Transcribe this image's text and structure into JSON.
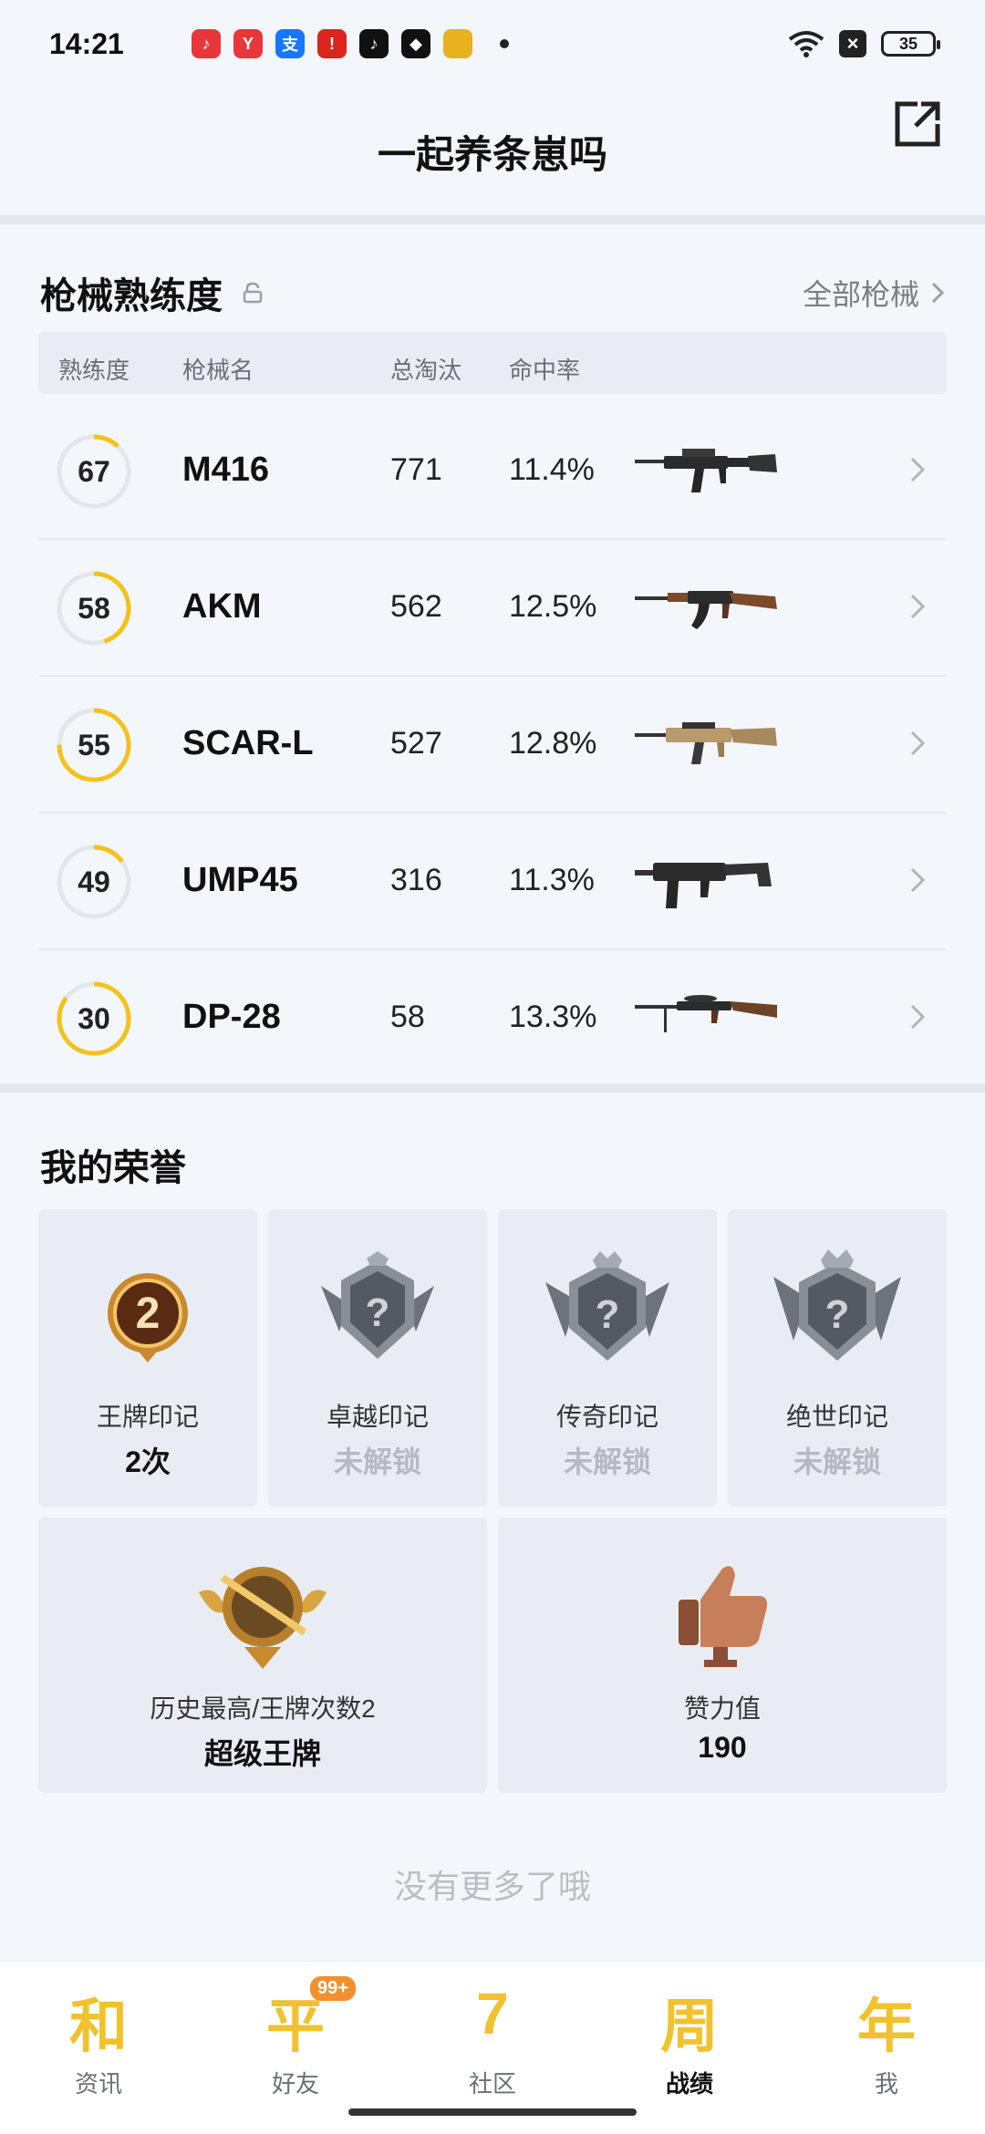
{
  "status_bar": {
    "time": "14:21",
    "battery": "35",
    "apps": [
      {
        "icon": "music-app-icon",
        "color": "#e8363a",
        "glyph": "♪"
      },
      {
        "icon": "red-app-icon",
        "color": "#e8363a",
        "glyph": "Y"
      },
      {
        "icon": "alipay-icon",
        "color": "#1677ff",
        "glyph": "支"
      },
      {
        "icon": "notice-app-icon",
        "color": "#d9251d",
        "glyph": "!"
      },
      {
        "icon": "tiktok-icon",
        "color": "#111111",
        "glyph": "♪"
      },
      {
        "icon": "shield-app-icon",
        "color": "#111111",
        "glyph": "◆"
      },
      {
        "icon": "game-app-icon",
        "color": "#e7b11f",
        "glyph": ""
      }
    ]
  },
  "header": {
    "title": "一起养条崽吗"
  },
  "weapons": {
    "title": "枪械熟练度",
    "all_link": "全部枪械",
    "columns": {
      "proficiency": "熟练度",
      "name": "枪械名",
      "kills": "总淘汰",
      "accuracy": "命中率"
    },
    "rows": [
      {
        "proficiency": "67",
        "progress": 0.12,
        "name": "M416",
        "kills": "771",
        "accuracy": "11.4%"
      },
      {
        "proficiency": "58",
        "progress": 0.45,
        "name": "AKM",
        "kills": "562",
        "accuracy": "12.5%"
      },
      {
        "proficiency": "55",
        "progress": 0.75,
        "name": "SCAR-L",
        "kills": "527",
        "accuracy": "12.8%"
      },
      {
        "proficiency": "49",
        "progress": 0.15,
        "name": "UMP45",
        "kills": "316",
        "accuracy": "11.3%"
      },
      {
        "proficiency": "30",
        "progress": 0.85,
        "name": "DP-28",
        "kills": "58",
        "accuracy": "13.3%"
      }
    ]
  },
  "honors": {
    "title": "我的荣誉",
    "marks": [
      {
        "label": "王牌印记",
        "value": "2次",
        "locked": false
      },
      {
        "label": "卓越印记",
        "value": "未解锁",
        "locked": true
      },
      {
        "label": "传奇印记",
        "value": "未解锁",
        "locked": true
      },
      {
        "label": "绝世印记",
        "value": "未解锁",
        "locked": true
      }
    ],
    "best": {
      "label": "历史最高/王牌次数2",
      "value": "超级王牌"
    },
    "likes": {
      "label": "赞力值",
      "value": "190"
    }
  },
  "footer_text": "没有更多了哦",
  "nav": [
    {
      "glyph": "和",
      "label": "资讯",
      "active": false
    },
    {
      "glyph": "平",
      "label": "好友",
      "active": false,
      "badge": "99+"
    },
    {
      "glyph": "7",
      "label": "社区",
      "active": false
    },
    {
      "glyph": "周",
      "label": "战绩",
      "active": true
    },
    {
      "glyph": "年",
      "label": "我",
      "active": false
    }
  ],
  "colors": {
    "accent": "#f5c21b",
    "ring_track": "#e3e6eb"
  }
}
